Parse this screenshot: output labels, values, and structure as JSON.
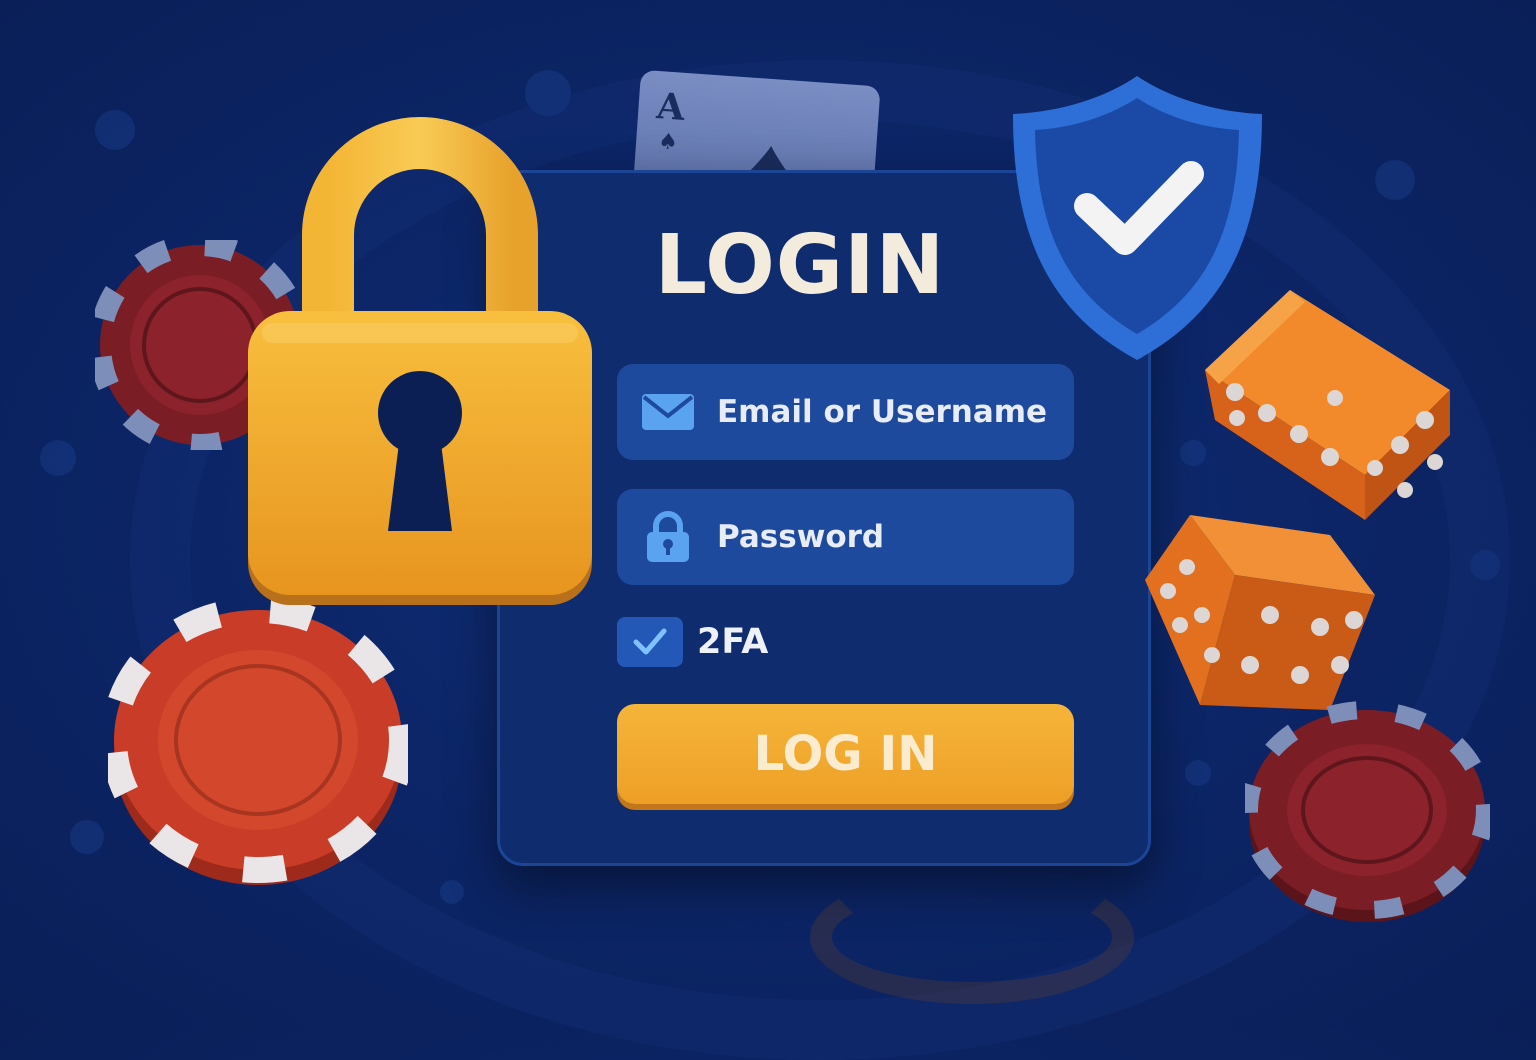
{
  "login_form": {
    "title": "LOGIN",
    "email_label": "Email or Username",
    "password_label": "Password",
    "twofa_label": "2FA",
    "twofa_checked": true,
    "submit_label": "LOG IN"
  },
  "playing_card": {
    "rank": "A",
    "suit": "♠"
  },
  "icons": {
    "email": "envelope-icon",
    "password": "padlock-icon",
    "shield": "shield-check-icon",
    "lock": "padlock-icon"
  },
  "colors": {
    "background": "#0c2668",
    "panel": "#0f2c6e",
    "field": "#1e4a9e",
    "button": "#f2a82f",
    "title_text": "#f3ecdc",
    "shield": "#2d6fd6",
    "lock": "#f2ae2e",
    "dice": "#e9781f",
    "chip_red": "#c43a26",
    "chip_maroon": "#7a1d24"
  }
}
